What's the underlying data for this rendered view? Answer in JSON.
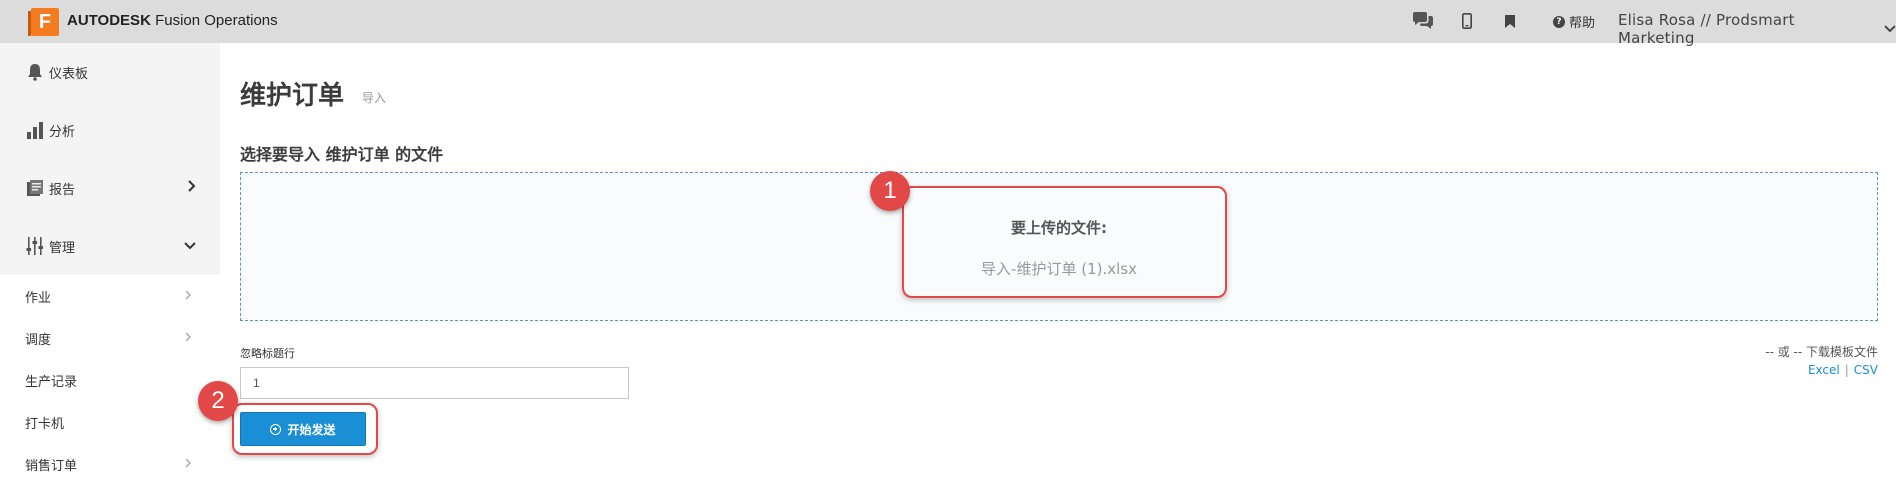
{
  "topbar": {
    "logo_letter": "F",
    "brand_bold": "AUTODESK",
    "brand_rest": "Fusion Operations",
    "icons": [
      "chat-icon",
      "mobile-icon",
      "bookmark-icon"
    ],
    "help_label": "帮助",
    "user_label": "Elisa Rosa // Prodsmart Marketing"
  },
  "sidebar": {
    "items": [
      {
        "label": "仪表板",
        "icon": "bell-icon"
      },
      {
        "label": "分析",
        "icon": "bar-chart-icon"
      },
      {
        "label": "报告",
        "icon": "report-icon"
      },
      {
        "label": "管理",
        "icon": "sliders-icon"
      }
    ],
    "sub_items": [
      {
        "label": "作业"
      },
      {
        "label": "调度"
      },
      {
        "label": "生产记录"
      },
      {
        "label": "打卡机"
      },
      {
        "label": "销售订单"
      }
    ]
  },
  "main": {
    "title": "维护订单",
    "subtitle": "导入",
    "section_title": "选择要导入 维护订单 的文件",
    "dropzone": {
      "label": "要上传的文件:",
      "file_name": "导入-维护订单 (1).xlsx"
    },
    "ignore_label": "忽略标题行",
    "ignore_value": "1",
    "start_button": "开始发送",
    "template_text": "-- 或 -- 下载模板文件",
    "template_excel": "Excel",
    "template_sep": "|",
    "template_csv": "CSV"
  },
  "annotations": {
    "marker1": "1",
    "marker2": "2",
    "color": "#e24848"
  }
}
